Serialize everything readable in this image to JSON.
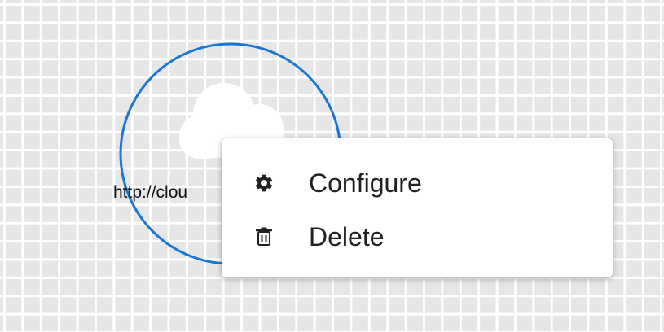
{
  "node": {
    "label": "http://clou",
    "icon": "cloud-icon",
    "selection_color": "#1976d2"
  },
  "menu": {
    "items": [
      {
        "label": "Configure",
        "icon": "gear-icon"
      },
      {
        "label": "Delete",
        "icon": "trash-icon"
      }
    ]
  }
}
